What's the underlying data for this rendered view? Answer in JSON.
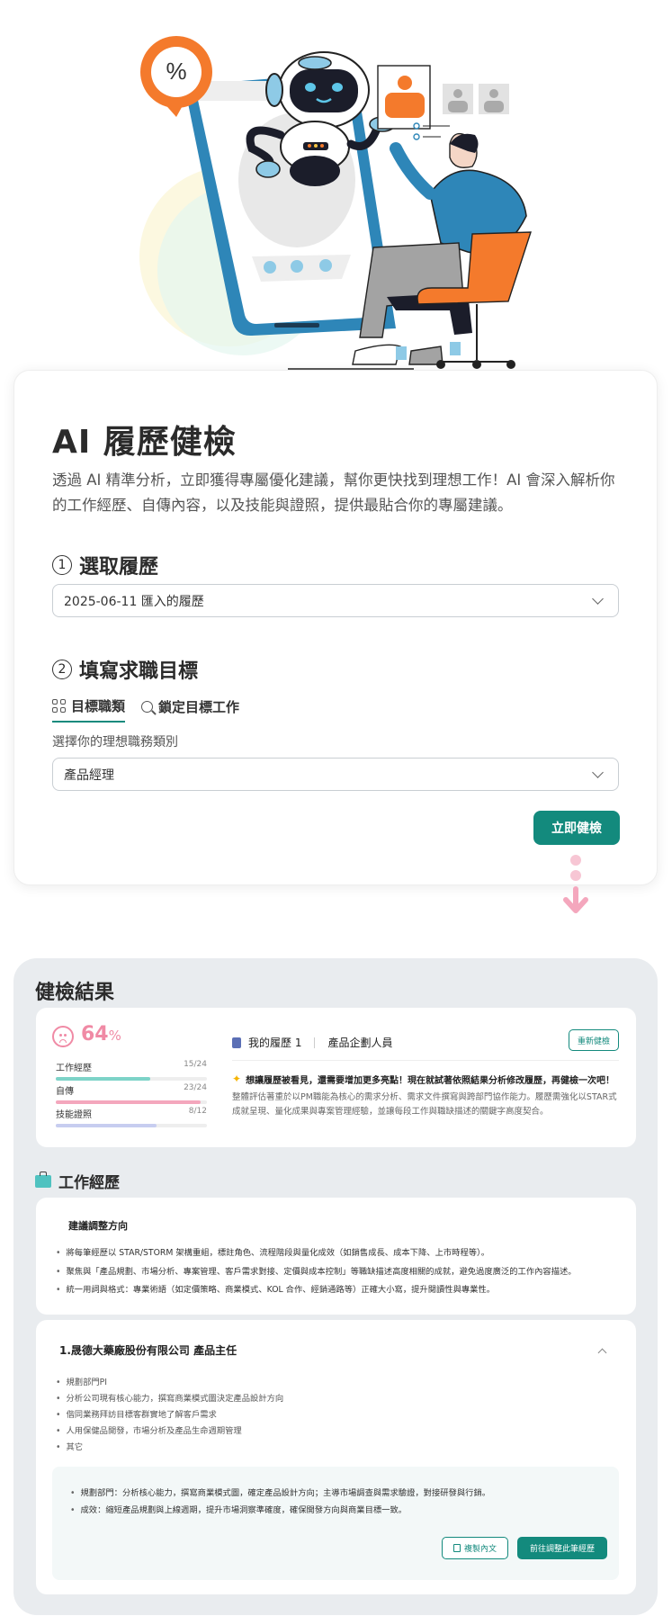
{
  "intro": {
    "title": "AI 履歷健檢",
    "description": "透過 AI 精準分析，立即獲得專屬優化建議，幫你更快找到理想工作！AI 會深入解析你的工作經歷、自傳內容，以及技能與證照，提供最貼合你的專屬建議。",
    "step1": {
      "number": "1",
      "label": "選取履歷",
      "selected": "2025-06-11 匯入的履歷"
    },
    "step2": {
      "number": "2",
      "label": "填寫求職目標",
      "tabs": [
        "目標職類",
        "鎖定目標工作"
      ],
      "sublabel": "選擇你的理想職務類別",
      "selected": "產品經理"
    },
    "cta": "立即健檢"
  },
  "hero": {
    "badge": "%"
  },
  "results": {
    "title": "健檢結果",
    "score": {
      "value": "64",
      "unit": "%"
    },
    "bars": [
      {
        "label": "工作經歷",
        "count": "15/24",
        "value": 0.625,
        "color": "#7dd3c8"
      },
      {
        "label": "自傳",
        "count": "23/24",
        "value": 0.958,
        "color": "#f4a7bd"
      },
      {
        "label": "技能證照",
        "count": "8/12",
        "value": 0.667,
        "color": "#c7cdf0"
      }
    ],
    "resume_name": "我的履歷 1",
    "resume_role": "產品企劃人員",
    "recheck": "重新健檢",
    "tip": "想讓履歷被看見，還需要增加更多亮點！現在就試著依照結果分析修改履歷，再健檢一次吧！",
    "tip_desc": "整體評估著重於以PM職能為核心的需求分析、需求文件撰寫與跨部門協作能力。履歷需強化以STAR式成就呈現、量化成果與專案管理經驗，並讓每段工作與職缺描述的關鍵字高度契合。",
    "work_section": "工作經歷",
    "advice": {
      "title": "建議調整方向",
      "items": [
        "將每筆經歷以 STAR/STORM 架構重組，標註角色、流程階段與量化成效（如銷售成長、成本下降、上市時程等）。",
        "聚焦與「產品規劃、市場分析、專案管理、客戶需求對接、定價與成本控制」等職缺描述高度相關的成就，避免過度廣泛的工作內容描述。",
        "統一用詞與格式：專業術語（如定價策略、商業模式、KOL 合作、經銷通路等）正確大小寫，提升閱讀性與專業性。"
      ]
    },
    "job": {
      "title": "1.晟德大藥廠股份有限公司 產品主任",
      "duties": [
        "規劃部門PI",
        "分析公司現有核心能力，撰寫商業模式圖決定產品設計方向",
        "偕同業務拜訪目標客群實地了解客戶需求",
        "人用保健品開發，市場分析及產品生命週期管理",
        "其它"
      ],
      "suggestions": [
        "規劃部門：分析核心能力，撰寫商業模式圖，確定產品設計方向；主導市場調查與需求驗證，對接研發與行銷。",
        "成效：縮短產品規劃與上線週期，提升市場洞察準確度，確保開發方向與商業目標一致。"
      ],
      "copy": "複製內文",
      "go": "前往調整此筆經歷"
    }
  }
}
